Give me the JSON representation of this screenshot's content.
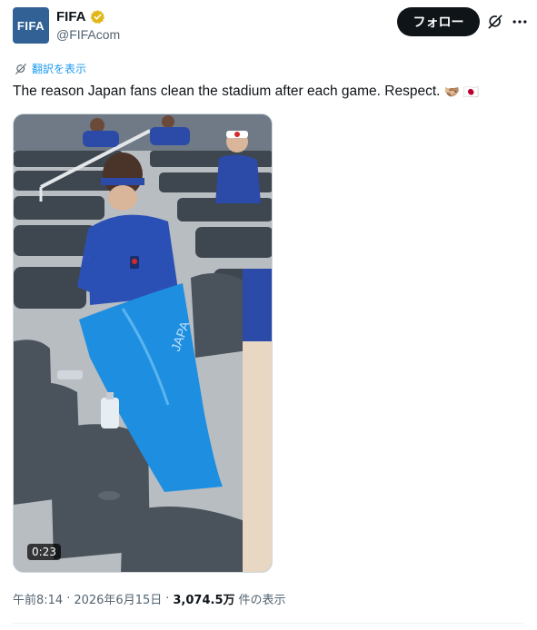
{
  "account": {
    "avatar_text": "FIFA",
    "display_name": "FIFA",
    "handle": "@FIFAcom",
    "verified_badge_icon": "gold-verified-icon",
    "avatar_color": "#326295"
  },
  "actions": {
    "follow_label": "フォロー",
    "grok_icon": "grok-icon",
    "more_icon": "more-icon"
  },
  "translate": {
    "label": "翻訳を表示",
    "icon": "translate-icon"
  },
  "tweet": {
    "text": "The reason Japan fans clean the stadium after each game. Respect.",
    "emojis": [
      "🫱🏼‍🫲🏽",
      "🇯🇵"
    ]
  },
  "media": {
    "type": "video",
    "duration": "0:23",
    "bag_text": "JAPA"
  },
  "meta": {
    "time": "午前8:14",
    "separator": "·",
    "date": "2026年6月15日",
    "separator2": "·",
    "views_count": "3,074.5万",
    "views_label": "件の表示"
  },
  "colors": {
    "link": "#1d9bf0",
    "follow_bg": "#0f1419",
    "verified": "#e2b719"
  }
}
